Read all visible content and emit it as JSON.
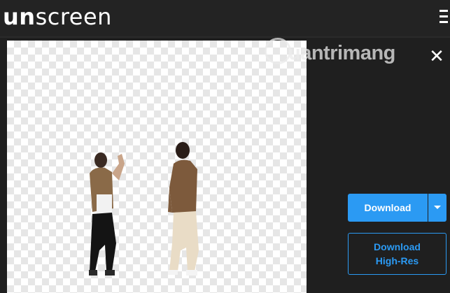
{
  "header": {
    "logo_part1": "un",
    "logo_part2": "screen"
  },
  "watermark": {
    "text": "uantrimang"
  },
  "close_glyph": "✕",
  "actions": {
    "download_label": "Download",
    "download_highres_line1": "Download",
    "download_highres_line2": "High-Res"
  },
  "colors": {
    "accent": "#2b9af3",
    "background": "#1f1f1f"
  }
}
